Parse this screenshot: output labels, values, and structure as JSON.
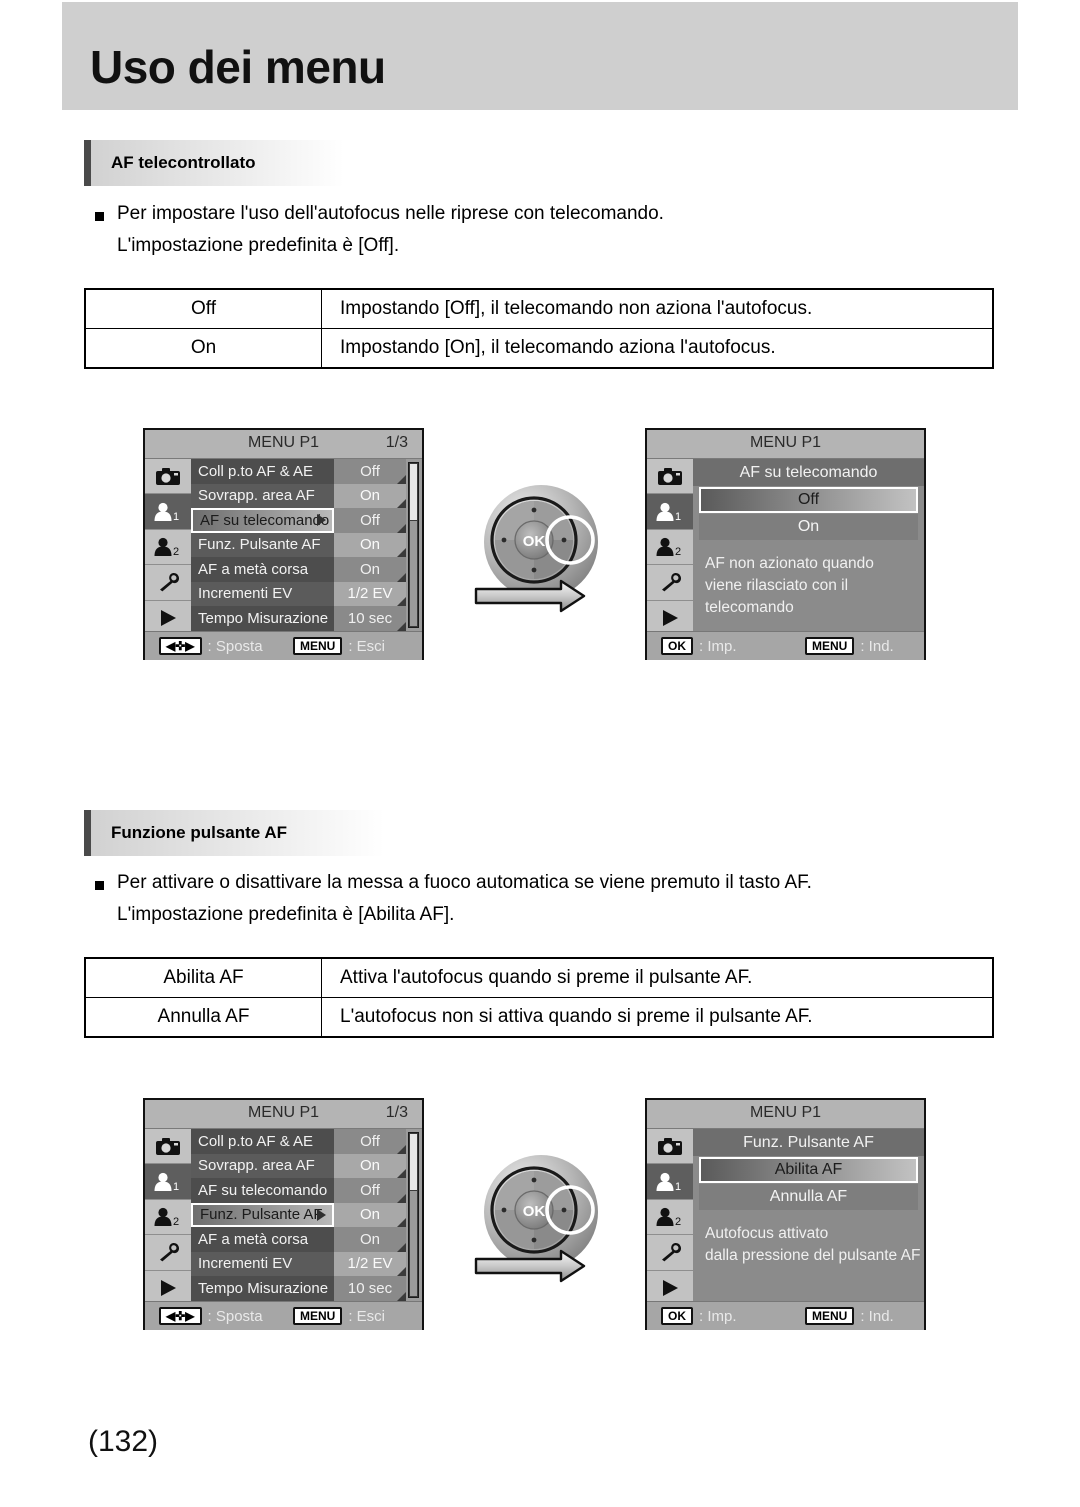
{
  "header": {
    "title": "Uso dei menu"
  },
  "sections": [
    {
      "heading": "AF telecontrollato",
      "bullet_line1": "Per impostare l'uso dell'autofocus nelle riprese con telecomando.",
      "bullet_line2": "L'impostazione predefinita è [Off].",
      "table": {
        "rows": [
          {
            "key": "Off",
            "value": "Impostando [Off], il telecomando non aziona l'autofocus."
          },
          {
            "key": "On",
            "value": "Impostando [On], il telecomando aziona l'autofocus."
          }
        ]
      }
    },
    {
      "heading": "Funzione pulsante AF",
      "bullet_line1": "Per attivare o disattivare la messa a fuoco automatica se viene premuto il tasto AF.",
      "bullet_line2": "L'impostazione predefinita è [Abilita AF].",
      "table": {
        "rows": [
          {
            "key": "Abilita AF",
            "value": "Attiva l'autofocus quando si preme il pulsante AF."
          },
          {
            "key": "Annulla AF",
            "value": "L'autofocus non si attiva quando si preme il pulsante AF."
          }
        ]
      }
    }
  ],
  "lcd_menu_a": {
    "title": "MENU P1",
    "page_indicator": "1/3",
    "sidebar_icons": [
      "camera-icon",
      "person-1-icon",
      "person-2-icon",
      "wrench-icon",
      "play-icon"
    ],
    "active_sidebar_index": 1,
    "rows": [
      {
        "label": "Coll p.to AF & AE",
        "value": "Off"
      },
      {
        "label": "Sovrapp. area AF",
        "value": "On"
      },
      {
        "label": "AF su telecomando",
        "value": "Off"
      },
      {
        "label": "Funz. Pulsante AF",
        "value": "On"
      },
      {
        "label": "AF a metà corsa",
        "value": "On"
      },
      {
        "label": "Incrementi EV",
        "value": "1/2 EV"
      },
      {
        "label": "Tempo Misurazione",
        "value": "10 sec"
      }
    ],
    "selected_row_index": 2,
    "footer": {
      "key1": "◀✜▶",
      "text1": ": Sposta",
      "key2": "MENU",
      "text2": ": Esci"
    }
  },
  "lcd_opt_a": {
    "title": "MENU P1",
    "option_title": "AF su telecomando",
    "options": [
      "Off",
      "On"
    ],
    "selected_option_index": 0,
    "description_lines": [
      "AF non azionato quando",
      "viene rilasciato con il",
      "telecomando"
    ],
    "footer": {
      "key1": "OK",
      "text1": ": Imp.",
      "key2": "MENU",
      "text2": ": Ind."
    }
  },
  "lcd_menu_b": {
    "title": "MENU P1",
    "page_indicator": "1/3",
    "sidebar_icons": [
      "camera-icon",
      "person-1-icon",
      "person-2-icon",
      "wrench-icon",
      "play-icon"
    ],
    "active_sidebar_index": 1,
    "rows": [
      {
        "label": "Coll p.to AF & AE",
        "value": "Off"
      },
      {
        "label": "Sovrapp. area AF",
        "value": "On"
      },
      {
        "label": "AF su telecomando",
        "value": "Off"
      },
      {
        "label": "Funz. Pulsante AF",
        "value": "On"
      },
      {
        "label": "AF a metà corsa",
        "value": "On"
      },
      {
        "label": "Incrementi EV",
        "value": "1/2 EV"
      },
      {
        "label": "Tempo Misurazione",
        "value": "10 sec"
      }
    ],
    "selected_row_index": 3,
    "footer": {
      "key1": "◀✜▶",
      "text1": ": Sposta",
      "key2": "MENU",
      "text2": ": Esci"
    }
  },
  "lcd_opt_b": {
    "title": "MENU P1",
    "option_title": "Funz. Pulsante AF",
    "options": [
      "Abilita AF",
      "Annulla AF"
    ],
    "selected_option_index": 0,
    "description_lines": [
      "Autofocus attivato",
      "dalla pressione del pulsante AF"
    ],
    "footer": {
      "key1": "OK",
      "text1": ": Imp.",
      "key2": "MENU",
      "text2": ": Ind."
    }
  },
  "dpad": {
    "center_label": "OK",
    "highlighted_direction": "right",
    "arrow_direction": "right"
  },
  "page_number": "(132)",
  "colors": {
    "header_band": "#cfcfcf",
    "heading_bar": "#4a4a4a",
    "lcd_bg": "#9b9b9b",
    "lcd_selected_border": "#ffffff"
  }
}
